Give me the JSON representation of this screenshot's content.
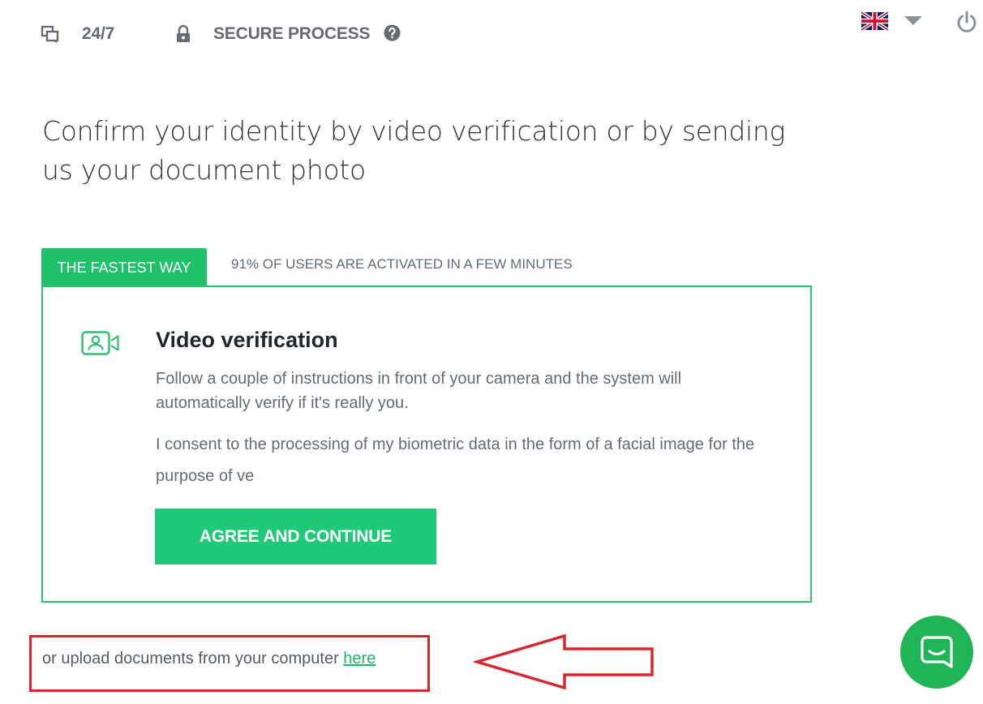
{
  "topbar": {
    "support_label": "24/7",
    "support_icon": "chat-bubbles-icon",
    "secure_label": "SECURE PROCESS",
    "secure_icon": "lock-icon",
    "help_icon": "question-circle-icon",
    "language_icon": "uk-flag-icon",
    "language_dropdown_icon": "caret-down-icon",
    "logout_icon": "power-icon"
  },
  "page": {
    "title": "Confirm your identity by video verification or by sending us your document photo"
  },
  "tabs": {
    "active_label": "THE FASTEST WAY",
    "note": "91% OF USERS ARE ACTIVATED IN A FEW MINUTES"
  },
  "card": {
    "icon": "video-person-icon",
    "title": "Video verification",
    "description": "Follow a couple of instructions in front of your camera and the system will automatically verify if it's really you.",
    "consent": "I consent to the processing of my biometric data in the form of a facial image for the purpose of ve",
    "button_label": "AGREE AND CONTINUE"
  },
  "upload": {
    "text": "or upload documents from your computer",
    "link_label": "here"
  },
  "chat": {
    "icon": "chat-widget-icon"
  },
  "colors": {
    "brand_green": "#20c978",
    "highlight_red": "#d8262e",
    "text_gray": "#646b73"
  }
}
